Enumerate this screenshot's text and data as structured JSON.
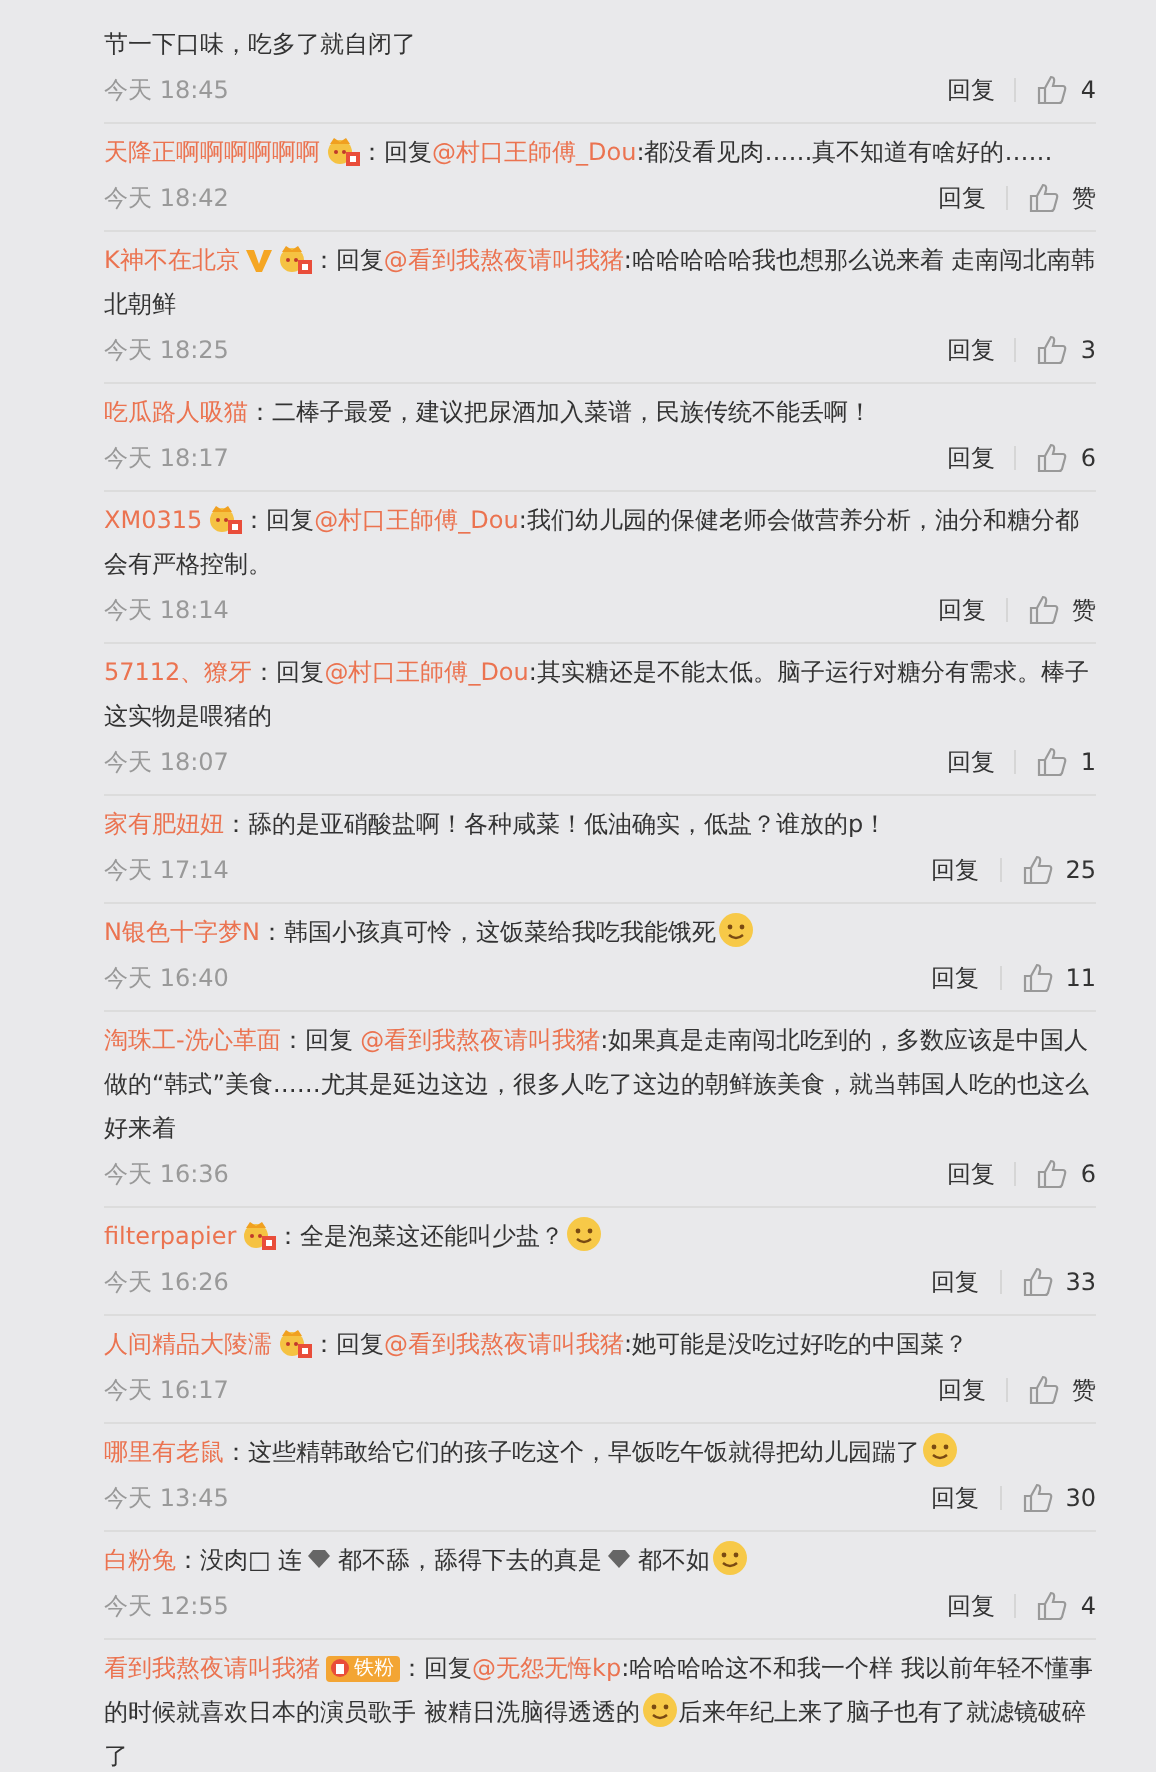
{
  "comments": [
    {
      "content": [
        {
          "kind": "text",
          "text": "节一下口味，吃多了就自闭了"
        }
      ],
      "time": "今天 18:45",
      "reply": "回复",
      "likes": "4"
    },
    {
      "user": "天降正啊啊啊啊啊啊",
      "badges": [
        {
          "kind": "crown"
        }
      ],
      "content": [
        {
          "kind": "text",
          "text": "：回复"
        },
        {
          "kind": "mention",
          "text": "@村口王師傅_Dou"
        },
        {
          "kind": "text",
          "text": ":都没看见肉……真不知道有啥好的……"
        }
      ],
      "time": "今天 18:42",
      "reply": "回复",
      "likes": "赞"
    },
    {
      "user": "K神不在北京",
      "badges": [
        {
          "kind": "v"
        },
        {
          "kind": "crown"
        }
      ],
      "content": [
        {
          "kind": "text",
          "text": "：回复"
        },
        {
          "kind": "mention",
          "text": "@看到我熬夜请叫我猪"
        },
        {
          "kind": "text",
          "text": ":哈哈哈哈哈我也想那么说来着 走南闯北南韩北朝鲜"
        }
      ],
      "time": "今天 18:25",
      "reply": "回复",
      "likes": "3"
    },
    {
      "user": "吃瓜路人吸猫",
      "content": [
        {
          "kind": "text",
          "text": "：二棒子最爱，建议把尿酒加入菜谱，民族传统不能丢啊！"
        }
      ],
      "time": "今天 18:17",
      "reply": "回复",
      "likes": "6"
    },
    {
      "user": "XM0315",
      "badges": [
        {
          "kind": "crown"
        }
      ],
      "content": [
        {
          "kind": "text",
          "text": "：回复"
        },
        {
          "kind": "mention",
          "text": "@村口王師傅_Dou"
        },
        {
          "kind": "text",
          "text": ":我们幼儿园的保健老师会做营养分析，油分和糖分都会有严格控制。"
        }
      ],
      "time": "今天 18:14",
      "reply": "回复",
      "likes": "赞"
    },
    {
      "user": "57112、獠牙",
      "content": [
        {
          "kind": "text",
          "text": "：回复"
        },
        {
          "kind": "mention",
          "text": "@村口王師傅_Dou"
        },
        {
          "kind": "text",
          "text": ":其实糖还是不能太低。脑子运行对糖分有需求。棒子这实物是喂猪的"
        }
      ],
      "time": "今天 18:07",
      "reply": "回复",
      "likes": "1"
    },
    {
      "user": "家有肥妞妞",
      "content": [
        {
          "kind": "text",
          "text": "：舔的是亚硝酸盐啊！各种咸菜！低油确实，低盐？谁放的p！"
        }
      ],
      "time": "今天 17:14",
      "reply": "回复",
      "likes": "25"
    },
    {
      "user": "N银色十字梦N",
      "content": [
        {
          "kind": "text",
          "text": "：韩国小孩真可怜，这饭菜给我吃我能饿死"
        },
        {
          "kind": "emoji"
        }
      ],
      "time": "今天 16:40",
      "reply": "回复",
      "likes": "11"
    },
    {
      "user": "淘珠工-洗心革面",
      "content": [
        {
          "kind": "text",
          "text": "：回复 "
        },
        {
          "kind": "mention",
          "text": "@看到我熬夜请叫我猪"
        },
        {
          "kind": "text",
          "text": ":如果真是走南闯北吃到的，多数应该是中国人做的“韩式”美食……尤其是延边这边，很多人吃了这边的朝鲜族美食，就当韩国人吃的也这么好来着"
        }
      ],
      "time": "今天 16:36",
      "reply": "回复",
      "likes": "6"
    },
    {
      "user": "filterpapier",
      "badges": [
        {
          "kind": "crown"
        }
      ],
      "content": [
        {
          "kind": "text",
          "text": "：全是泡菜这还能叫少盐？"
        },
        {
          "kind": "emoji"
        }
      ],
      "time": "今天 16:26",
      "reply": "回复",
      "likes": "33"
    },
    {
      "user": "人间精品大陵濡",
      "badges": [
        {
          "kind": "crown"
        }
      ],
      "content": [
        {
          "kind": "text",
          "text": "：回复"
        },
        {
          "kind": "mention",
          "text": "@看到我熬夜请叫我猪"
        },
        {
          "kind": "text",
          "text": ":她可能是没吃过好吃的中国菜？"
        }
      ],
      "time": "今天 16:17",
      "reply": "回复",
      "likes": "赞"
    },
    {
      "user": "哪里有老鼠",
      "content": [
        {
          "kind": "text",
          "text": "：这些精韩敢给它们的孩子吃这个，早饭吃午饭就得把幼儿园踹了"
        },
        {
          "kind": "emoji"
        }
      ],
      "time": "今天 13:45",
      "reply": "回复",
      "likes": "30"
    },
    {
      "user": "白粉兔",
      "content": [
        {
          "kind": "text",
          "text": "：没肉□ 连"
        },
        {
          "kind": "gem"
        },
        {
          "kind": "text",
          "text": " 都不舔，舔得下去的真是"
        },
        {
          "kind": "gem"
        },
        {
          "kind": "text",
          "text": " 都不如"
        },
        {
          "kind": "emoji"
        }
      ],
      "time": "今天 12:55",
      "reply": "回复",
      "likes": "4"
    },
    {
      "user": "看到我熬夜请叫我猪",
      "badges": [
        {
          "kind": "fan",
          "label": "铁粉"
        }
      ],
      "content": [
        {
          "kind": "text",
          "text": "：回复"
        },
        {
          "kind": "mention",
          "text": "@无怨无悔kp"
        },
        {
          "kind": "text",
          "text": ":哈哈哈哈这不和我一个样 我以前年轻不懂事的时候就喜欢日本的演员歌手 被精日洗脑得透透的"
        },
        {
          "kind": "emoji"
        },
        {
          "kind": "text",
          "text": "后来年纪上来了脑子也有了就滤镜破碎了"
        }
      ]
    }
  ]
}
